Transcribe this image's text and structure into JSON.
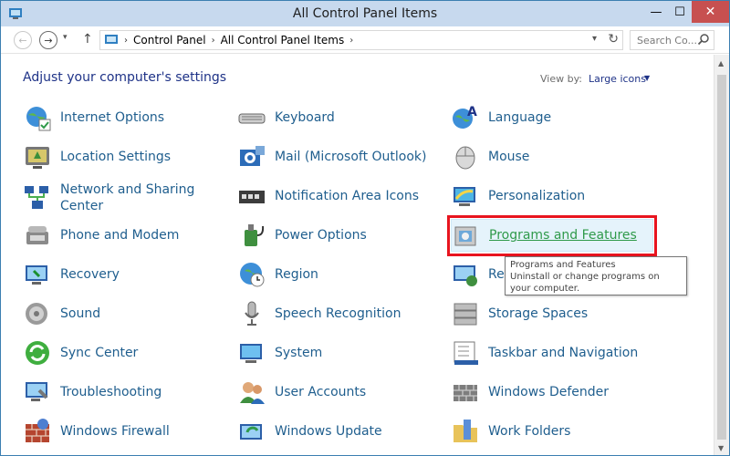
{
  "window": {
    "title": "All Control Panel Items"
  },
  "titlebar": {
    "minimize": "—",
    "maximize": "☐",
    "close": "✕"
  },
  "navigation": {
    "back": "←",
    "forward": "→",
    "recent": "▾",
    "up": "↑",
    "breadcrumb": [
      "Control Panel",
      "All Control Panel Items"
    ],
    "breadcrumb_sep": "›",
    "address_dropdown": "▾",
    "refresh": "↻",
    "search_placeholder": "Search Co..."
  },
  "page": {
    "heading": "Adjust your computer's settings",
    "view_by_label": "View by:",
    "view_by_value": "Large icons",
    "view_by_caret": "▼"
  },
  "items": [
    {
      "label": "Internet Options",
      "icon": "internet-options-icon"
    },
    {
      "label": "Keyboard",
      "icon": "keyboard-icon"
    },
    {
      "label": "Language",
      "icon": "language-icon"
    },
    {
      "label": "Location Settings",
      "icon": "location-settings-icon"
    },
    {
      "label": "Mail (Microsoft Outlook)",
      "icon": "mail-icon"
    },
    {
      "label": "Mouse",
      "icon": "mouse-icon"
    },
    {
      "label": "Network and Sharing Center",
      "icon": "network-sharing-icon"
    },
    {
      "label": "Notification Area Icons",
      "icon": "notification-area-icon"
    },
    {
      "label": "Personalization",
      "icon": "personalization-icon"
    },
    {
      "label": "Phone and Modem",
      "icon": "phone-modem-icon"
    },
    {
      "label": "Power Options",
      "icon": "power-options-icon"
    },
    {
      "label": "Programs and Features",
      "icon": "programs-features-icon"
    },
    {
      "label": "Recovery",
      "icon": "recovery-icon"
    },
    {
      "label": "Region",
      "icon": "region-icon"
    },
    {
      "label": "Re",
      "icon": "remoteapp-icon"
    },
    {
      "label": "Sound",
      "icon": "sound-icon"
    },
    {
      "label": "Speech Recognition",
      "icon": "speech-recognition-icon"
    },
    {
      "label": "Storage Spaces",
      "icon": "storage-spaces-icon"
    },
    {
      "label": "Sync Center",
      "icon": "sync-center-icon"
    },
    {
      "label": "System",
      "icon": "system-icon"
    },
    {
      "label": "Taskbar and Navigation",
      "icon": "taskbar-navigation-icon"
    },
    {
      "label": "Troubleshooting",
      "icon": "troubleshooting-icon"
    },
    {
      "label": "User Accounts",
      "icon": "user-accounts-icon"
    },
    {
      "label": "Windows Defender",
      "icon": "windows-defender-icon"
    },
    {
      "label": "Windows Firewall",
      "icon": "windows-firewall-icon"
    },
    {
      "label": "Windows Update",
      "icon": "windows-update-icon"
    },
    {
      "label": "Work Folders",
      "icon": "work-folders-icon"
    }
  ],
  "tooltip": {
    "title": "Programs and Features",
    "description": "Uninstall or change programs on your computer."
  },
  "scrollbar": {
    "up": "▲",
    "down": "▼"
  },
  "colors": {
    "link": "#1f5e8e",
    "heading": "#1e3287",
    "highlight": "#e8141f",
    "selected_link": "#2f9a4a"
  }
}
